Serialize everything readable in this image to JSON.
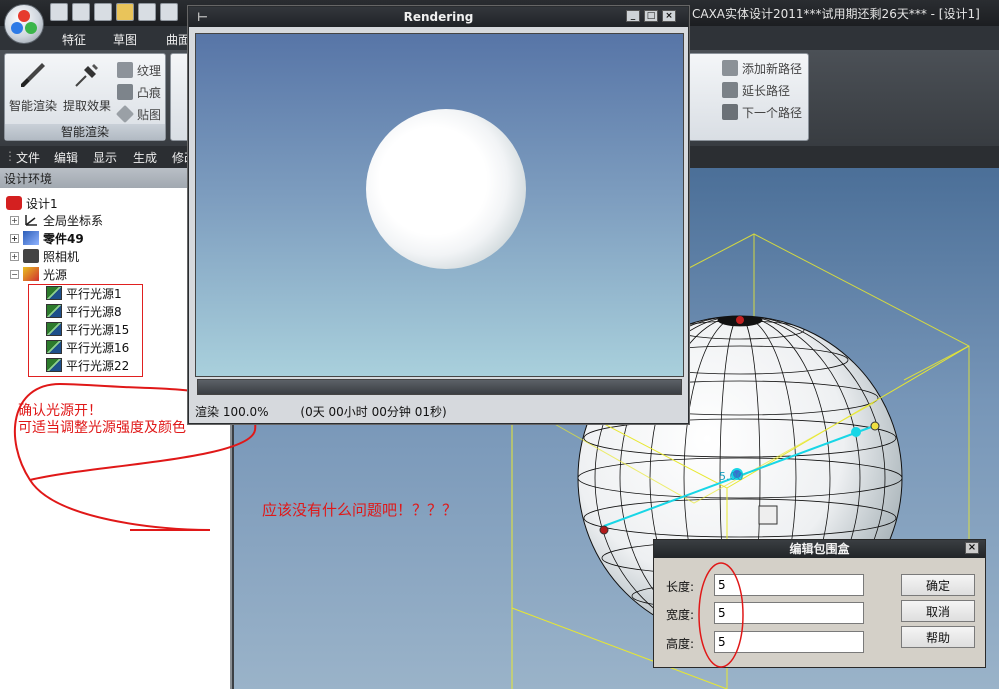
{
  "app": {
    "title": "CAXA实体设计2011***试用期还剩26天*** - [设计1]"
  },
  "ribbon": {
    "tabs": [
      "特征",
      "草图",
      "曲面"
    ],
    "group_render": {
      "label": "智能渲染",
      "big_buttons": [
        "智能渲染",
        "提取效果"
      ],
      "small_buttons": [
        "纹理",
        "凸痕",
        "贴图"
      ]
    },
    "group_path": {
      "small_buttons": [
        "添加新路径",
        "延长路径",
        "下一个路径"
      ]
    }
  },
  "menu": {
    "items": [
      "文件",
      "编辑",
      "显示",
      "生成",
      "修改"
    ]
  },
  "tree": {
    "header": "设计环境",
    "root": "设计1",
    "items": [
      "全局坐标系",
      "零件49",
      "照相机",
      "光源"
    ],
    "lights": [
      "平行光源1",
      "平行光源8",
      "平行光源15",
      "平行光源16",
      "平行光源22"
    ]
  },
  "annotations": {
    "note1": "确认光源开！",
    "note2": "可适当调整光源强度及颜色",
    "note3": "应该没有什么问题吧！？？？"
  },
  "render_window": {
    "title": "Rendering",
    "status_label": "渲染 100.0%",
    "status_time": "(0天 00小时 00分钟 01秒)"
  },
  "viewport": {
    "dim_label": "5.00"
  },
  "bbox_dialog": {
    "title": "编辑包围盒",
    "length_label": "长度:",
    "length_value": "5",
    "width_label": "宽度:",
    "width_value": "5",
    "height_label": "高度:",
    "height_value": "5",
    "ok_label": "确定",
    "cancel_label": "取消",
    "help_label": "帮助"
  },
  "colors": {
    "annotation": "#e01818",
    "accent_cyan": "#18d6e6",
    "bbox_yellow": "#e8e830"
  }
}
